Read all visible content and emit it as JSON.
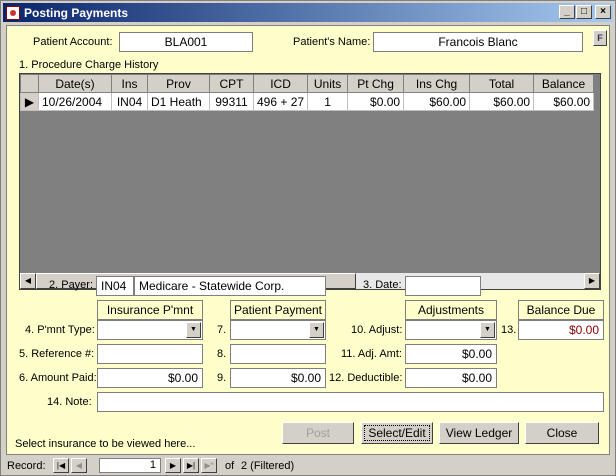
{
  "window": {
    "title": "Posting Payments",
    "min_label": "_",
    "max_label": "□",
    "close_label": "×"
  },
  "header": {
    "patient_account_label": "Patient Account:",
    "patient_account_value": "BLA001",
    "patient_name_label": "Patient's Name:",
    "patient_name_value": "Francois Blanc",
    "filter_button_label": "F"
  },
  "grid": {
    "title": "1. Procedure Charge History",
    "columns": [
      "Date(s)",
      "Ins",
      "Prov",
      "CPT",
      "ICD",
      "Units",
      "Pt Chg",
      "Ins Chg",
      "Total",
      "Balance"
    ],
    "rows": [
      [
        "10/26/2004",
        "IN04",
        "D1 Heath",
        "99311",
        "496 + 27",
        "1",
        "$0.00",
        "$60.00",
        "$60.00",
        "$60.00"
      ]
    ],
    "row_selector": "▶"
  },
  "payer": {
    "label": "2. Payer:",
    "code": "IN04",
    "name": "Medicare - Statewide Corp."
  },
  "date": {
    "label": "3. Date:",
    "value": ""
  },
  "sections": {
    "insurance_header": "Insurance P'mnt",
    "patient_header": "Patient Payment",
    "adjustments_header": "Adjustments",
    "balance_due_header": "Balance Due"
  },
  "rows": {
    "pmnt_type_label": "4. P'mnt Type:",
    "seven_label": "7.",
    "adjust_label": "10. Adjust:",
    "thirteen_label": "13.",
    "balance_due_value": "$0.00",
    "reference_label": "5. Reference #:",
    "eight_label": "8.",
    "adj_amt_label": "11. Adj. Amt:",
    "adj_amt_value": "$0.00",
    "amount_paid_label": "6. Amount Paid:",
    "amount_paid_value": "$0.00",
    "nine_label": "9.",
    "patient_paid_value": "$0.00",
    "deductible_label": "12. Deductible:",
    "deductible_value": "$0.00",
    "note_label": "14. Note:",
    "note_value": ""
  },
  "footer": {
    "hint": "Select insurance to be viewed here...",
    "post_label": "Post",
    "select_edit_label": "Select/Edit",
    "view_ledger_label": "View Ledger",
    "close_label": "Close"
  },
  "status": {
    "record_label": "Record:",
    "record_value": "1",
    "of_label": "of",
    "count_text": "2  (Filtered)"
  }
}
